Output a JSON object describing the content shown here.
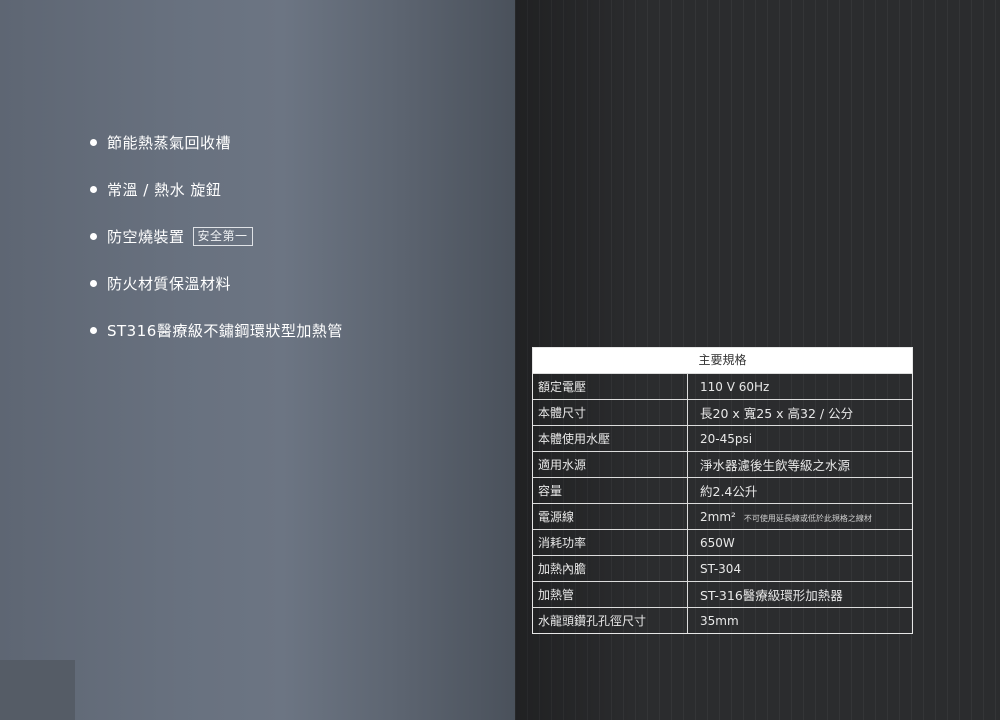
{
  "features": [
    {
      "text": "節能熱蒸氣回收槽",
      "tag": ""
    },
    {
      "text": "常溫 / 熱水 旋鈕",
      "tag": ""
    },
    {
      "text": "防空燒裝置",
      "tag": "安全第一"
    },
    {
      "text": "防火材質保溫材料",
      "tag": ""
    },
    {
      "text": "ST316醫療級不鏽鋼環狀型加熱管",
      "tag": ""
    }
  ],
  "spec_table": {
    "title": "主要規格",
    "rows": [
      {
        "label": "額定電壓",
        "value": "110 V 60Hz",
        "note": ""
      },
      {
        "label": "本體尺寸",
        "value": "長20 x 寬25 x 高32 / 公分",
        "note": ""
      },
      {
        "label": "本體使用水壓",
        "value": "20-45psi",
        "note": ""
      },
      {
        "label": "適用水源",
        "value": "淨水器濾後生飲等級之水源",
        "note": ""
      },
      {
        "label": "容量",
        "value": "約2.4公升",
        "note": ""
      },
      {
        "label": "電源線",
        "value": "2mm²",
        "note": "不可使用延長線或低於此規格之線材"
      },
      {
        "label": "消耗功率",
        "value": "650W",
        "note": ""
      },
      {
        "label": "加熱內膽",
        "value": "ST-304",
        "note": ""
      },
      {
        "label": "加熱管",
        "value": "ST-316醫療級環形加熱器",
        "note": ""
      },
      {
        "label": "水龍頭鑽孔孔徑尺寸",
        "value": "35mm",
        "note": ""
      }
    ]
  }
}
